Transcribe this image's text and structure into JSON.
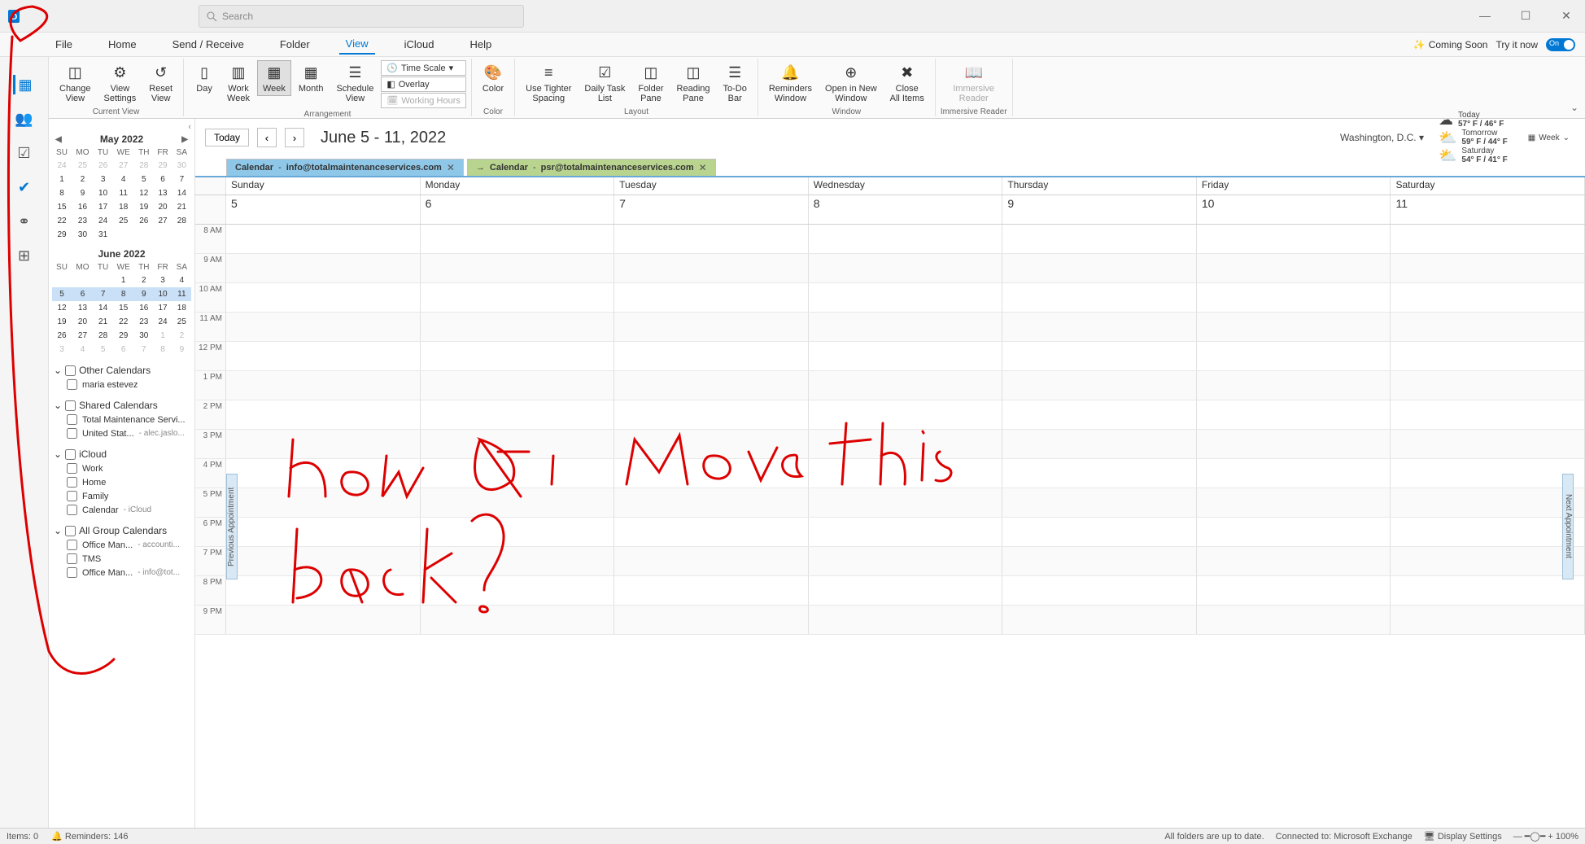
{
  "titlebar": {
    "search_placeholder": "Search"
  },
  "menubar": {
    "items": [
      "File",
      "Home",
      "Send / Receive",
      "Folder",
      "View",
      "iCloud",
      "Help"
    ],
    "active": 4,
    "coming_soon": "Coming Soon",
    "try_it": "Try it now",
    "toggle": "On"
  },
  "ribbon": {
    "groups": {
      "current_view": {
        "label": "Current View",
        "change_view": "Change\nView",
        "view_settings": "View\nSettings",
        "reset_view": "Reset\nView"
      },
      "arrangement": {
        "label": "Arrangement",
        "day": "Day",
        "work_week": "Work\nWeek",
        "week": "Week",
        "month": "Month",
        "schedule_view": "Schedule\nView",
        "time_scale": "Time Scale",
        "overlay": "Overlay",
        "working_hours": "Working Hours"
      },
      "color": {
        "label": "Color",
        "color": "Color"
      },
      "layout": {
        "label": "Layout",
        "tighter": "Use Tighter\nSpacing",
        "daily_task": "Daily Task\nList",
        "folder_pane": "Folder\nPane",
        "reading_pane": "Reading\nPane",
        "todo_bar": "To-Do\nBar"
      },
      "window": {
        "label": "Window",
        "reminders": "Reminders\nWindow",
        "open_new": "Open in New\nWindow",
        "close_all": "Close\nAll Items"
      },
      "immersive": {
        "label": "Immersive Reader",
        "reader": "Immersive\nReader"
      }
    }
  },
  "leftnav": {
    "items": [
      "mail",
      "calendar",
      "people",
      "tasks",
      "todo",
      "groups",
      "addins"
    ]
  },
  "minicals": {
    "may": {
      "title": "May 2022",
      "dow": [
        "SU",
        "MO",
        "TU",
        "WE",
        "TH",
        "FR",
        "SA"
      ],
      "rows": [
        [
          {
            "d": 24,
            "o": 1
          },
          {
            "d": 25,
            "o": 1
          },
          {
            "d": 26,
            "o": 1
          },
          {
            "d": 27,
            "o": 1
          },
          {
            "d": 28,
            "o": 1
          },
          {
            "d": 29,
            "o": 1
          },
          {
            "d": 30,
            "o": 1
          }
        ],
        [
          {
            "d": 1
          },
          {
            "d": 2
          },
          {
            "d": 3
          },
          {
            "d": 4
          },
          {
            "d": 5
          },
          {
            "d": 6
          },
          {
            "d": 7
          }
        ],
        [
          {
            "d": 8
          },
          {
            "d": 9
          },
          {
            "d": 10
          },
          {
            "d": 11
          },
          {
            "d": 12
          },
          {
            "d": 13
          },
          {
            "d": 14
          }
        ],
        [
          {
            "d": 15
          },
          {
            "d": 16
          },
          {
            "d": 17
          },
          {
            "d": 18
          },
          {
            "d": 19
          },
          {
            "d": 20
          },
          {
            "d": 21
          }
        ],
        [
          {
            "d": 22
          },
          {
            "d": 23
          },
          {
            "d": 24
          },
          {
            "d": 25
          },
          {
            "d": 26
          },
          {
            "d": 27
          },
          {
            "d": 28
          }
        ],
        [
          {
            "d": 29
          },
          {
            "d": 30
          },
          {
            "d": 31
          }
        ]
      ]
    },
    "june": {
      "title": "June 2022",
      "dow": [
        "SU",
        "MO",
        "TU",
        "WE",
        "TH",
        "FR",
        "SA"
      ],
      "rows": [
        [
          null,
          null,
          null,
          {
            "d": 1
          },
          {
            "d": 2
          },
          {
            "d": 3
          },
          {
            "d": 4
          }
        ],
        [
          {
            "d": 5,
            "s": 1
          },
          {
            "d": 6,
            "s": 1
          },
          {
            "d": 7,
            "s": 1
          },
          {
            "d": 8,
            "s": 1
          },
          {
            "d": 9,
            "s": 1
          },
          {
            "d": 10,
            "s": 1
          },
          {
            "d": 11,
            "s": 1
          }
        ],
        [
          {
            "d": 12
          },
          {
            "d": 13
          },
          {
            "d": 14
          },
          {
            "d": 15
          },
          {
            "d": 16
          },
          {
            "d": 17
          },
          {
            "d": 18
          }
        ],
        [
          {
            "d": 19
          },
          {
            "d": 20
          },
          {
            "d": 21
          },
          {
            "d": 22
          },
          {
            "d": 23
          },
          {
            "d": 24
          },
          {
            "d": 25
          }
        ],
        [
          {
            "d": 26
          },
          {
            "d": 27
          },
          {
            "d": 28
          },
          {
            "d": 29
          },
          {
            "d": 30
          },
          {
            "d": 1,
            "o": 1
          },
          {
            "d": 2,
            "o": 1
          }
        ],
        [
          {
            "d": 3,
            "o": 1
          },
          {
            "d": 4,
            "o": 1
          },
          {
            "d": 5,
            "o": 1
          },
          {
            "d": 6,
            "o": 1
          },
          {
            "d": 7,
            "o": 1
          },
          {
            "d": 8,
            "o": 1
          },
          {
            "d": 9,
            "o": 1
          }
        ]
      ]
    }
  },
  "calgroups": [
    {
      "name": "Other Calendars",
      "items": [
        {
          "label": "maria estevez"
        }
      ]
    },
    {
      "name": "Shared Calendars",
      "items": [
        {
          "label": "Total Maintenance Servi..."
        },
        {
          "label": "United Stat...",
          "extra": "- alec.jaslo..."
        }
      ]
    },
    {
      "name": "iCloud",
      "items": [
        {
          "label": "Work"
        },
        {
          "label": "Home"
        },
        {
          "label": "Family"
        },
        {
          "label": "Calendar",
          "extra": "- iCloud"
        }
      ]
    },
    {
      "name": "All Group Calendars",
      "items": [
        {
          "label": "Office Man...",
          "extra": "- accounti..."
        },
        {
          "label": "TMS"
        },
        {
          "label": "Office Man...",
          "extra": "- info@tot..."
        }
      ]
    }
  ],
  "calheader": {
    "today": "Today",
    "range": "June 5 - 11, 2022",
    "location": "Washington, D.C.",
    "weather": [
      {
        "label": "Today",
        "temp": "57° F / 46° F",
        "icon": "☁"
      },
      {
        "label": "Tomorrow",
        "temp": "59° F / 44° F",
        "icon": "⛅"
      },
      {
        "label": "Saturday",
        "temp": "54° F / 41° F",
        "icon": "⛅"
      }
    ],
    "view_label": "Week"
  },
  "caltabs": [
    {
      "prefix": "Calendar",
      "sep": " - ",
      "email": "info@totalmaintenanceservices.com"
    },
    {
      "prefix": "Calendar",
      "sep": " - ",
      "email": "psr@totalmaintenanceservices.com"
    }
  ],
  "week": {
    "days": [
      "Sunday",
      "Monday",
      "Tuesday",
      "Wednesday",
      "Thursday",
      "Friday",
      "Saturday"
    ],
    "dates": [
      "5",
      "6",
      "7",
      "8",
      "9",
      "10",
      "11"
    ],
    "hours": [
      "8 AM",
      "9 AM",
      "10 AM",
      "11 AM",
      "12 PM",
      "1 PM",
      "2 PM",
      "3 PM",
      "4 PM",
      "5 PM",
      "6 PM",
      "7 PM",
      "8 PM",
      "9 PM"
    ]
  },
  "appnav": {
    "prev": "Previous Appointment",
    "next": "Next Appointment"
  },
  "statusbar": {
    "items": "Items: 0",
    "reminders": "Reminders: 146",
    "folders": "All folders are up to date.",
    "connected": "Connected to: Microsoft Exchange",
    "display": "Display Settings",
    "zoom": "100%"
  },
  "annotation": "how do i move this back?"
}
